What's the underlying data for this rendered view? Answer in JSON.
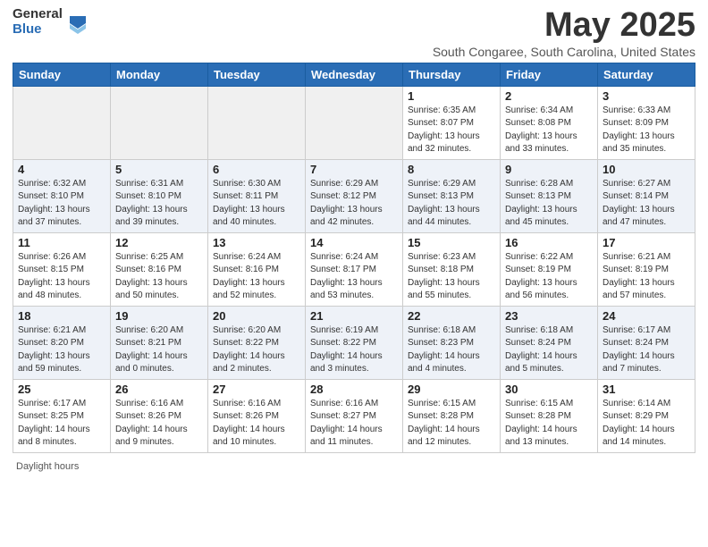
{
  "logo": {
    "general": "General",
    "blue": "Blue"
  },
  "title": "May 2025",
  "subtitle": "South Congaree, South Carolina, United States",
  "days_of_week": [
    "Sunday",
    "Monday",
    "Tuesday",
    "Wednesday",
    "Thursday",
    "Friday",
    "Saturday"
  ],
  "weeks": [
    [
      {
        "day": "",
        "info": ""
      },
      {
        "day": "",
        "info": ""
      },
      {
        "day": "",
        "info": ""
      },
      {
        "day": "",
        "info": ""
      },
      {
        "day": "1",
        "info": "Sunrise: 6:35 AM\nSunset: 8:07 PM\nDaylight: 13 hours and 32 minutes."
      },
      {
        "day": "2",
        "info": "Sunrise: 6:34 AM\nSunset: 8:08 PM\nDaylight: 13 hours and 33 minutes."
      },
      {
        "day": "3",
        "info": "Sunrise: 6:33 AM\nSunset: 8:09 PM\nDaylight: 13 hours and 35 minutes."
      }
    ],
    [
      {
        "day": "4",
        "info": "Sunrise: 6:32 AM\nSunset: 8:10 PM\nDaylight: 13 hours and 37 minutes."
      },
      {
        "day": "5",
        "info": "Sunrise: 6:31 AM\nSunset: 8:10 PM\nDaylight: 13 hours and 39 minutes."
      },
      {
        "day": "6",
        "info": "Sunrise: 6:30 AM\nSunset: 8:11 PM\nDaylight: 13 hours and 40 minutes."
      },
      {
        "day": "7",
        "info": "Sunrise: 6:29 AM\nSunset: 8:12 PM\nDaylight: 13 hours and 42 minutes."
      },
      {
        "day": "8",
        "info": "Sunrise: 6:29 AM\nSunset: 8:13 PM\nDaylight: 13 hours and 44 minutes."
      },
      {
        "day": "9",
        "info": "Sunrise: 6:28 AM\nSunset: 8:13 PM\nDaylight: 13 hours and 45 minutes."
      },
      {
        "day": "10",
        "info": "Sunrise: 6:27 AM\nSunset: 8:14 PM\nDaylight: 13 hours and 47 minutes."
      }
    ],
    [
      {
        "day": "11",
        "info": "Sunrise: 6:26 AM\nSunset: 8:15 PM\nDaylight: 13 hours and 48 minutes."
      },
      {
        "day": "12",
        "info": "Sunrise: 6:25 AM\nSunset: 8:16 PM\nDaylight: 13 hours and 50 minutes."
      },
      {
        "day": "13",
        "info": "Sunrise: 6:24 AM\nSunset: 8:16 PM\nDaylight: 13 hours and 52 minutes."
      },
      {
        "day": "14",
        "info": "Sunrise: 6:24 AM\nSunset: 8:17 PM\nDaylight: 13 hours and 53 minutes."
      },
      {
        "day": "15",
        "info": "Sunrise: 6:23 AM\nSunset: 8:18 PM\nDaylight: 13 hours and 55 minutes."
      },
      {
        "day": "16",
        "info": "Sunrise: 6:22 AM\nSunset: 8:19 PM\nDaylight: 13 hours and 56 minutes."
      },
      {
        "day": "17",
        "info": "Sunrise: 6:21 AM\nSunset: 8:19 PM\nDaylight: 13 hours and 57 minutes."
      }
    ],
    [
      {
        "day": "18",
        "info": "Sunrise: 6:21 AM\nSunset: 8:20 PM\nDaylight: 13 hours and 59 minutes."
      },
      {
        "day": "19",
        "info": "Sunrise: 6:20 AM\nSunset: 8:21 PM\nDaylight: 14 hours and 0 minutes."
      },
      {
        "day": "20",
        "info": "Sunrise: 6:20 AM\nSunset: 8:22 PM\nDaylight: 14 hours and 2 minutes."
      },
      {
        "day": "21",
        "info": "Sunrise: 6:19 AM\nSunset: 8:22 PM\nDaylight: 14 hours and 3 minutes."
      },
      {
        "day": "22",
        "info": "Sunrise: 6:18 AM\nSunset: 8:23 PM\nDaylight: 14 hours and 4 minutes."
      },
      {
        "day": "23",
        "info": "Sunrise: 6:18 AM\nSunset: 8:24 PM\nDaylight: 14 hours and 5 minutes."
      },
      {
        "day": "24",
        "info": "Sunrise: 6:17 AM\nSunset: 8:24 PM\nDaylight: 14 hours and 7 minutes."
      }
    ],
    [
      {
        "day": "25",
        "info": "Sunrise: 6:17 AM\nSunset: 8:25 PM\nDaylight: 14 hours and 8 minutes."
      },
      {
        "day": "26",
        "info": "Sunrise: 6:16 AM\nSunset: 8:26 PM\nDaylight: 14 hours and 9 minutes."
      },
      {
        "day": "27",
        "info": "Sunrise: 6:16 AM\nSunset: 8:26 PM\nDaylight: 14 hours and 10 minutes."
      },
      {
        "day": "28",
        "info": "Sunrise: 6:16 AM\nSunset: 8:27 PM\nDaylight: 14 hours and 11 minutes."
      },
      {
        "day": "29",
        "info": "Sunrise: 6:15 AM\nSunset: 8:28 PM\nDaylight: 14 hours and 12 minutes."
      },
      {
        "day": "30",
        "info": "Sunrise: 6:15 AM\nSunset: 8:28 PM\nDaylight: 14 hours and 13 minutes."
      },
      {
        "day": "31",
        "info": "Sunrise: 6:14 AM\nSunset: 8:29 PM\nDaylight: 14 hours and 14 minutes."
      }
    ]
  ],
  "footer": {
    "daylight_hours": "Daylight hours"
  }
}
